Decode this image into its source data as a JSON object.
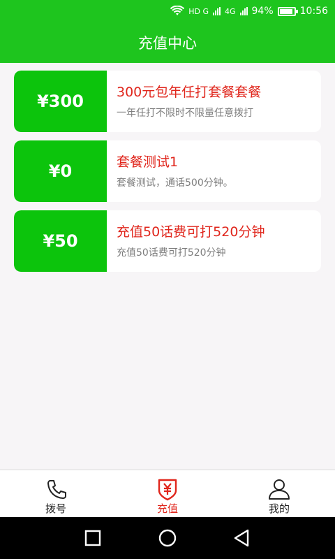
{
  "status_bar": {
    "network1": "HD G",
    "network2": "4G",
    "battery": "94%",
    "battery_level": 0.94,
    "time": "10:56"
  },
  "app_bar": {
    "title": "充值中心"
  },
  "packages": [
    {
      "price": "¥300",
      "title": "300元包年任打套餐套餐",
      "desc": "一年任打不限时不限量任意拨打"
    },
    {
      "price": "¥0",
      "title": "套餐测试1",
      "desc": "套餐测试，通话500分钟。"
    },
    {
      "price": "¥50",
      "title": "充值50话费可打520分钟",
      "desc": "充值50话费可打520分钟"
    }
  ],
  "bottom_nav": [
    {
      "label": "拨号",
      "icon": "phone-icon",
      "active": false
    },
    {
      "label": "充值",
      "icon": "yuan-shield-icon",
      "active": true
    },
    {
      "label": "我的",
      "icon": "user-icon",
      "active": false
    }
  ],
  "colors": {
    "primary": "#1ec51e",
    "price_bg": "#0cc40c",
    "accent": "#e0261c"
  },
  "system_nav": {
    "icons": [
      "recent-apps-icon",
      "home-icon",
      "back-icon"
    ]
  }
}
